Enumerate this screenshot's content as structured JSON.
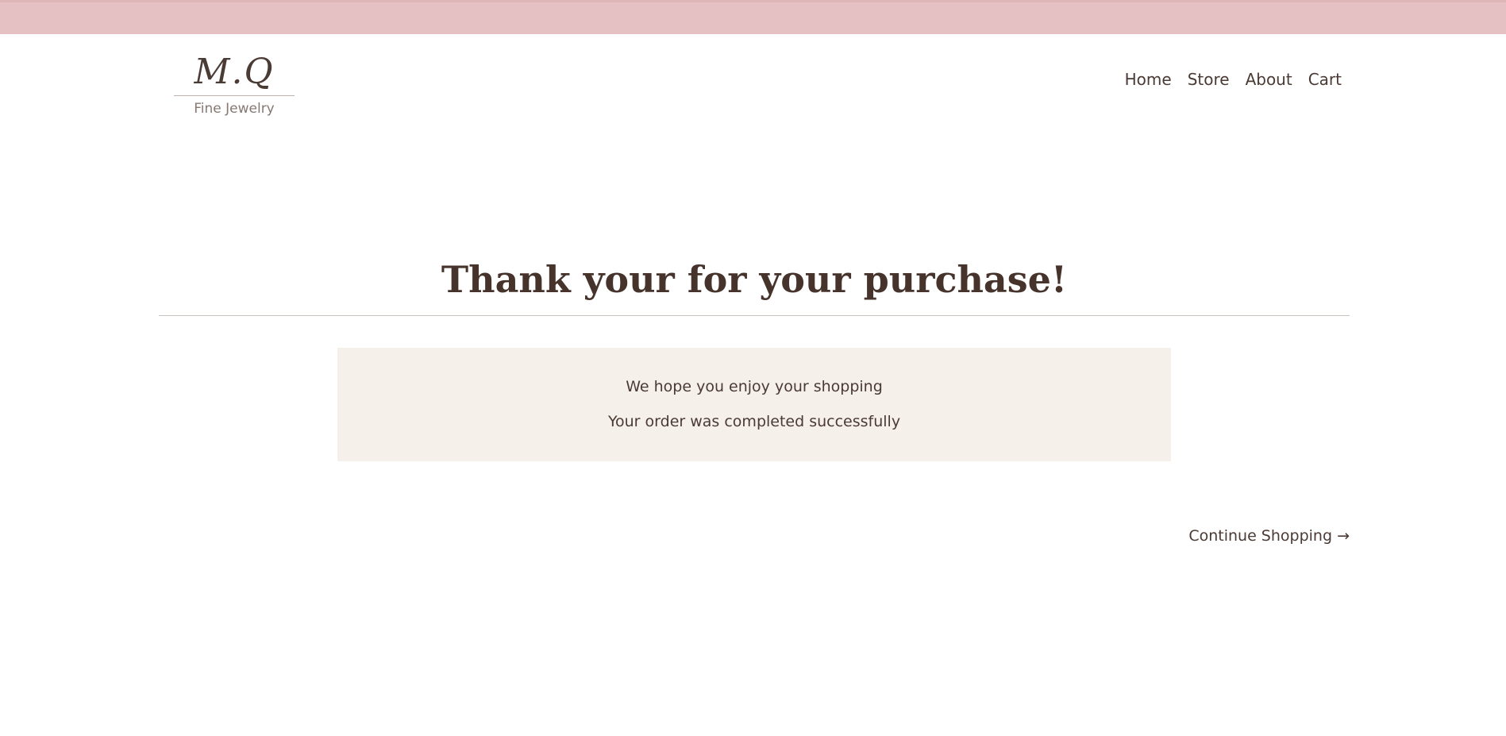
{
  "brand": {
    "mark": "M.Q",
    "tagline": "Fine Jewelry"
  },
  "nav": {
    "items": [
      {
        "label": "Home"
      },
      {
        "label": "Store"
      },
      {
        "label": "About"
      },
      {
        "label": "Cart"
      }
    ]
  },
  "main": {
    "heading": "Thank your for your purchase!",
    "messages": [
      "We hope you enjoy your shopping",
      "Your order was completed successfully"
    ],
    "continue_label": "Continue Shopping →"
  },
  "colors": {
    "top_band": "#e6c1c3",
    "text": "#4a3a33",
    "message_bg": "#f6f0eb"
  }
}
